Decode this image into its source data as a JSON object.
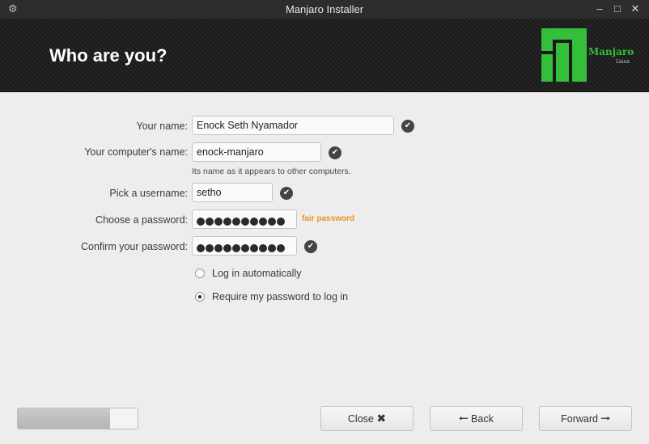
{
  "window": {
    "title": "Manjaro Installer",
    "gear_icon": "gear-icon",
    "minimize": "–",
    "maximize": "□",
    "close": "✕"
  },
  "header": {
    "heading": "Who are you?",
    "logo_text": "Manjaro",
    "logo_sub": "Linux"
  },
  "form": {
    "name_label": "Your name:",
    "name_value": "Enock Seth Nyamador",
    "computer_label": "Your computer's name:",
    "computer_value": "enock-manjaro",
    "computer_hint": "Its name as it appears to other computers.",
    "username_label": "Pick a username:",
    "username_value": "setho",
    "password_label": "Choose a password:",
    "password_strength": "fair password",
    "confirm_label": "Confirm your password:",
    "password_length": 10
  },
  "login": {
    "auto_label": "Log in automatically",
    "require_label": "Require my password to log in",
    "selected": "require"
  },
  "progress": {
    "value": 0.77
  },
  "buttons": {
    "close": "Close",
    "back": "Back",
    "forward": "Forward"
  },
  "colors": {
    "accent_green": "#34be3a",
    "strength_orange": "#f0901e",
    "check_bg": "#444444"
  }
}
